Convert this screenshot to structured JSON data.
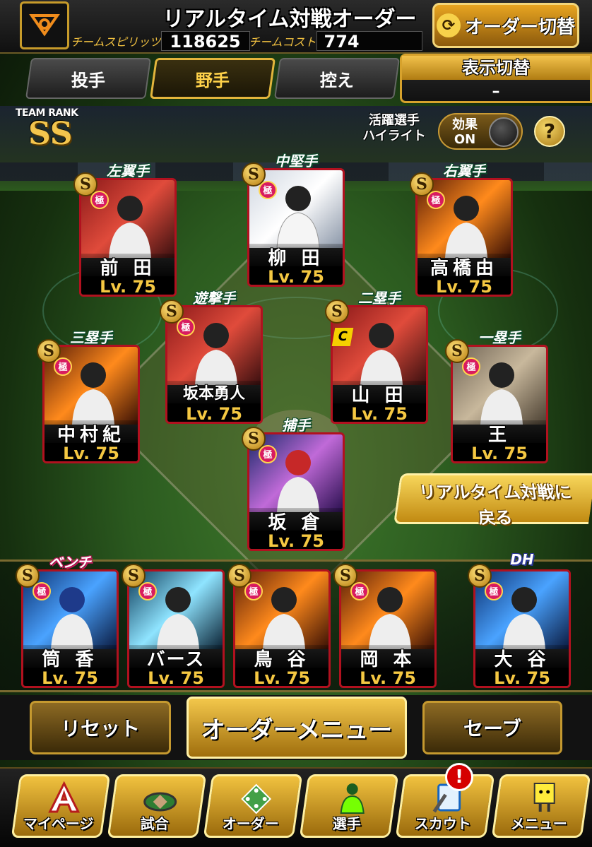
{
  "header": {
    "title": "リアルタイム対戦オーダー",
    "team_spirits_label": "チームスピリッツ",
    "team_spirits_value": "118625",
    "team_cost_label": "チームコスト",
    "team_cost_value": "774",
    "order_switch_label": "オーダー切替"
  },
  "tabs": [
    {
      "label": "投手",
      "active": false
    },
    {
      "label": "野手",
      "active": true
    },
    {
      "label": "控え",
      "active": false
    }
  ],
  "display_switch": {
    "title": "表示切替",
    "value": "–"
  },
  "team_rank": {
    "label": "TEAM RANK",
    "value": "SS"
  },
  "highlight": {
    "label_line1": "活躍選手",
    "label_line2": "ハイライト",
    "toggle_line1": "効果",
    "toggle_line2": "ON",
    "help": "?"
  },
  "lineup": [
    {
      "position": "左翼手",
      "name": "前 田",
      "level": "Lv. 75",
      "badge": "S",
      "rarity": "極"
    },
    {
      "position": "中堅手",
      "name": "柳 田",
      "level": "Lv. 75",
      "badge": "S",
      "rarity": "極"
    },
    {
      "position": "右翼手",
      "name": "高橋由",
      "level": "Lv. 75",
      "badge": "S",
      "rarity": "極"
    },
    {
      "position": "遊撃手",
      "name": "坂本勇人",
      "level": "Lv. 75",
      "badge": "S",
      "rarity": "極"
    },
    {
      "position": "二塁手",
      "name": "山 田",
      "level": "Lv. 75",
      "badge": "S",
      "rarity": "極",
      "extra_badge": "C"
    },
    {
      "position": "三塁手",
      "name": "中村紀",
      "level": "Lv. 75",
      "badge": "S",
      "rarity": "極"
    },
    {
      "position": "一塁手",
      "name": "王",
      "level": "Lv. 75",
      "badge": "S",
      "rarity": "極"
    },
    {
      "position": "捕手",
      "name": "坂 倉",
      "level": "Lv. 75",
      "badge": "S",
      "rarity": "極"
    }
  ],
  "back_button": {
    "line1": "リアルタイム対戦に",
    "line2": "戻る"
  },
  "bench": [
    {
      "position": "ベンチ",
      "name": "筒 香",
      "level": "Lv. 75",
      "badge": "S",
      "rarity": "極"
    },
    {
      "position": "",
      "name": "バース",
      "level": "Lv. 75",
      "badge": "S",
      "rarity": "極"
    },
    {
      "position": "",
      "name": "鳥 谷",
      "level": "Lv. 75",
      "badge": "S",
      "rarity": "極"
    },
    {
      "position": "",
      "name": "岡 本",
      "level": "Lv. 75",
      "badge": "S",
      "rarity": "極"
    },
    {
      "position": "DH",
      "name": "大 谷",
      "level": "Lv. 75",
      "badge": "S",
      "rarity": "極"
    }
  ],
  "actions": {
    "reset": "リセット",
    "order_menu": "オーダーメニュー",
    "save": "セーブ"
  },
  "nav": [
    {
      "label": "マイページ",
      "icon": "mypage-icon"
    },
    {
      "label": "試合",
      "icon": "stadium-icon"
    },
    {
      "label": "オーダー",
      "icon": "order-icon"
    },
    {
      "label": "選手",
      "icon": "player-icon"
    },
    {
      "label": "スカウト",
      "icon": "scout-icon"
    },
    {
      "label": "メニュー",
      "icon": "menu-icon"
    }
  ],
  "notification": "!"
}
